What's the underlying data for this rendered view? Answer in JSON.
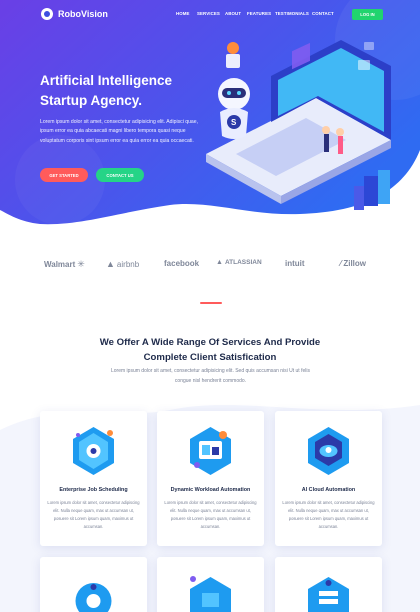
{
  "nav": {
    "brand": "RoboVision",
    "menu": [
      "HOME",
      "SERVICES",
      "ABOUT",
      "FEATURES",
      "TESTIMONIALS",
      "CONTACT"
    ],
    "login_label": "LOG IN"
  },
  "hero": {
    "title_line1": "Artificial Intelligence",
    "title_line2": "Startup Agency.",
    "text": "Lorem ipsum dolor sit amet, consectetur adipisicing elit. Adipisci quae, ipsum error ea quia abcaecati magni libero tempora quasi neque voluptatum corporis sint ipsum error ea quia error ea quia occaecati.",
    "start_label": "GET STARTED",
    "contact_label": "CONTACT US"
  },
  "brands": [
    "Walmart",
    "airbnb",
    "facebook",
    "ATLASSIAN",
    "intuit",
    "Zillow"
  ],
  "services": {
    "title_line1": "We Offer A Wide Range Of Services And Provide",
    "title_line2": "Complete Client Satisfication",
    "text": "Lorem ipsum dolor sit amet, consectetur adipisicing elit. Sed quis accumsan nisi Ut ut felis congue nisl hendrerit commodo.",
    "cards": [
      {
        "title": "Enterprise Job Scheduling",
        "text": "Lorem ipsum dolor sit amet, consectetur adipiscing elit. Nulla neque quam, max ut accumsan ut, posuere sit Lorem ipsum quam, maximus ut accumsan."
      },
      {
        "title": "Dynamic Workload Automation",
        "text": "Lorem ipsum dolor sit amet, consectetur adipiscing elit. Nulla neque quam, max ut accumsan ut, posuere sit Lorem ipsum quam, maximus ut accumsan."
      },
      {
        "title": "AI Cloud Automation",
        "text": "Lorem ipsum dolor sit amet, consectetur adipiscing elit. Nulla neque quam, max ut accumsan ut, posuere sit Lorem ipsum quam, maximus ut accumsan."
      }
    ]
  },
  "colors": {
    "hero_gradient_start": "#6a3fe6",
    "hero_gradient_end": "#2f6bf2",
    "accent_red": "#ff5b5b",
    "accent_green": "#25d487",
    "heading": "#1e2a4a"
  },
  "icons": [
    "robot-icon",
    "walmart-spark-icon",
    "airbnb-icon",
    "atlassian-icon",
    "zillow-icon",
    "gear-icon",
    "cloud-icon"
  ]
}
